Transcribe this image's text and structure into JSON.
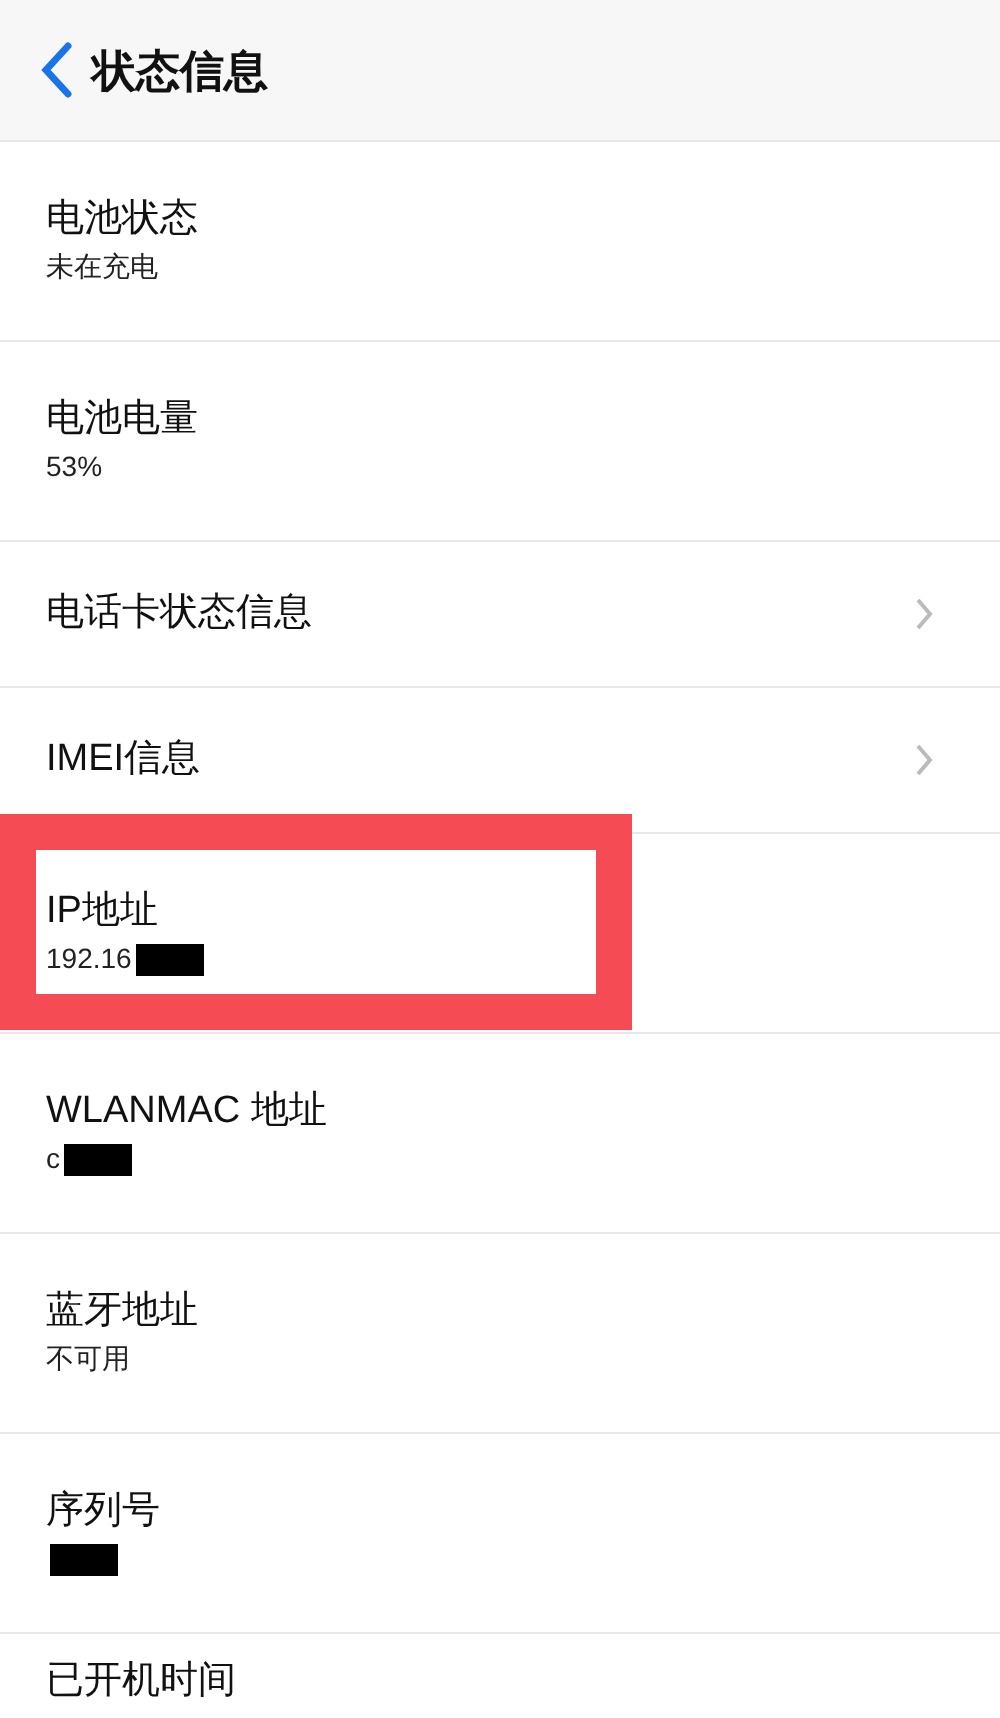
{
  "header": {
    "title": "状态信息"
  },
  "rows": [
    {
      "kind": "value",
      "label": "电池状态",
      "value": "未在充电",
      "highlighted": false,
      "redacted": false
    },
    {
      "kind": "value",
      "label": "电池电量",
      "value": "53%",
      "highlighted": false,
      "redacted": false
    },
    {
      "kind": "link",
      "label": "电话卡状态信息",
      "highlighted": false,
      "redacted": false
    },
    {
      "kind": "link",
      "label": "IMEI信息",
      "highlighted": false,
      "redacted": false
    },
    {
      "kind": "value",
      "label": "IP地址",
      "value": "192.16",
      "highlighted": true,
      "redacted": true
    },
    {
      "kind": "value",
      "label": "WLANMAC 地址",
      "value": "c",
      "highlighted": false,
      "redacted": true
    },
    {
      "kind": "value",
      "label": "蓝牙地址",
      "value": "不可用",
      "highlighted": false,
      "redacted": false
    },
    {
      "kind": "value",
      "label": "序列号",
      "highlighted": false,
      "redacted": true
    },
    {
      "kind": "title",
      "label": "已开机时间",
      "highlighted": false,
      "redacted": false
    }
  ]
}
